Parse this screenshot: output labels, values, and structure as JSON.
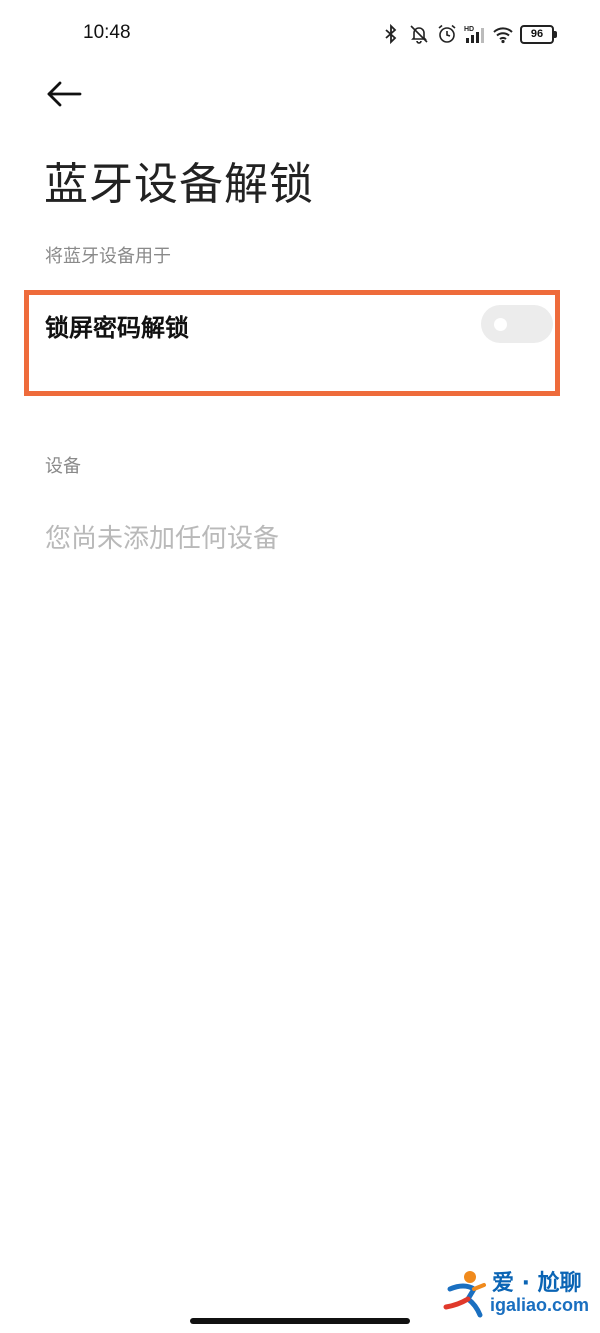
{
  "status_bar": {
    "time": "10:48",
    "battery": "96",
    "icons": [
      "bluetooth-icon",
      "mute-icon",
      "alarm-icon",
      "hd-signal-icon",
      "wifi-icon",
      "battery-icon"
    ]
  },
  "header": {
    "back_icon": "arrow-left-icon",
    "title": "蓝牙设备解锁"
  },
  "usage_section": {
    "label": "将蓝牙设备用于",
    "setting": {
      "label": "锁屏密码解锁",
      "toggle_state": "off"
    }
  },
  "devices_section": {
    "label": "设备",
    "empty_text": "您尚未添加任何设备"
  },
  "watermark": {
    "line1": "爱 · 尬聊",
    "line2": "igaliao.com"
  },
  "colors": {
    "highlight": "#ee6b3b",
    "toggle_off": "#ececec",
    "section_label": "#8a8a8a",
    "empty_text": "#b9b9b9",
    "watermark_blue": "#0a64b4"
  }
}
